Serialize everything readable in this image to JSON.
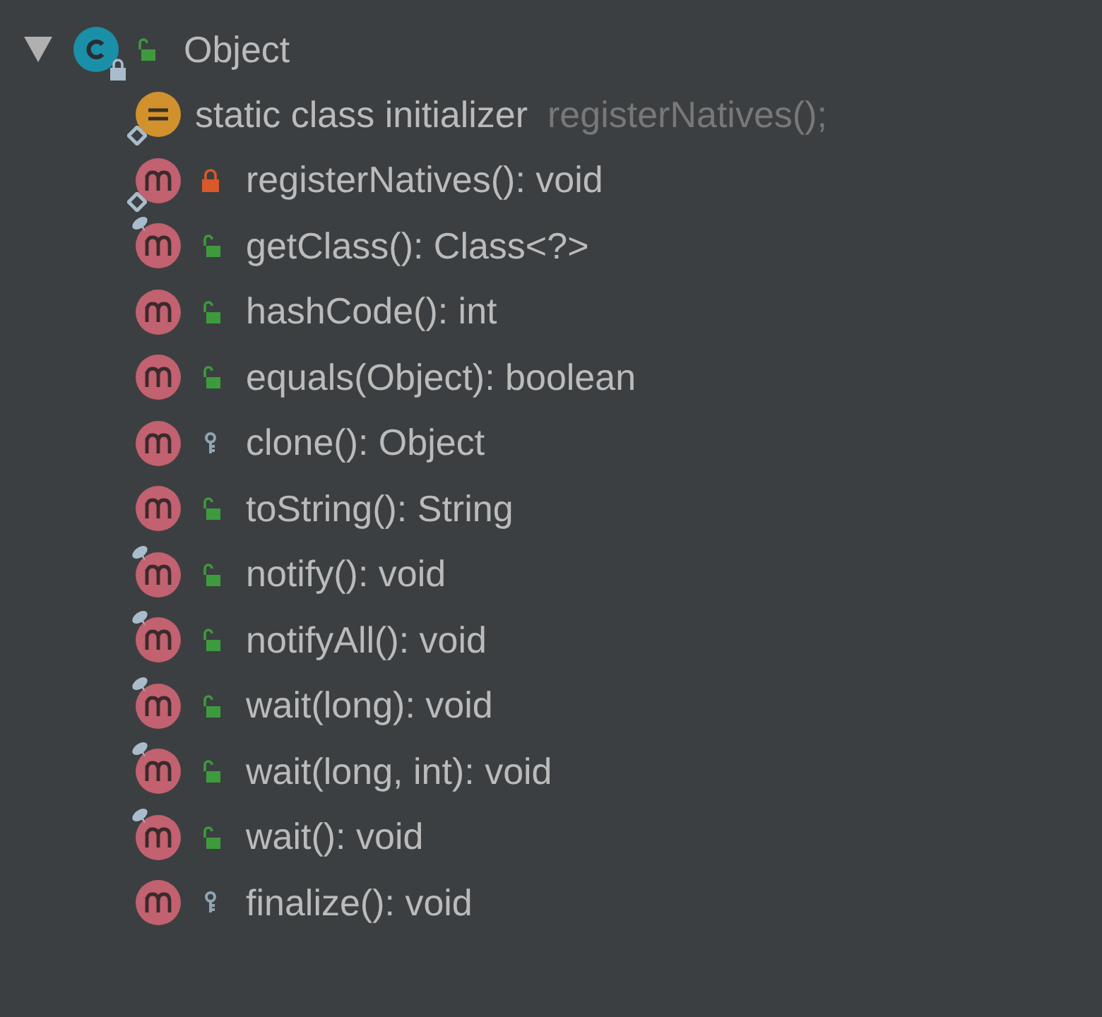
{
  "tree": {
    "expanded": true,
    "kind": "class",
    "overlay": {
      "kind": "lock"
    },
    "access": {
      "kind": "public"
    },
    "name": "Object",
    "children": [
      {
        "kind": "initializer",
        "overlay": {
          "kind": "static"
        },
        "name": "static class initializer",
        "hint": "registerNatives();"
      },
      {
        "kind": "method",
        "overlay": {
          "kind": "static"
        },
        "access": {
          "kind": "private"
        },
        "name": "registerNatives(): void"
      },
      {
        "kind": "method",
        "overlay": {
          "kind": "final"
        },
        "access": {
          "kind": "public"
        },
        "name": "getClass(): Class<?>"
      },
      {
        "kind": "method",
        "access": {
          "kind": "public"
        },
        "name": "hashCode(): int"
      },
      {
        "kind": "method",
        "access": {
          "kind": "public"
        },
        "name": "equals(Object): boolean"
      },
      {
        "kind": "method",
        "access": {
          "kind": "protected"
        },
        "name": "clone(): Object"
      },
      {
        "kind": "method",
        "access": {
          "kind": "public"
        },
        "name": "toString(): String"
      },
      {
        "kind": "method",
        "overlay": {
          "kind": "final"
        },
        "access": {
          "kind": "public"
        },
        "name": "notify(): void"
      },
      {
        "kind": "method",
        "overlay": {
          "kind": "final"
        },
        "access": {
          "kind": "public"
        },
        "name": "notifyAll(): void"
      },
      {
        "kind": "method",
        "overlay": {
          "kind": "final"
        },
        "access": {
          "kind": "public"
        },
        "name": "wait(long): void"
      },
      {
        "kind": "method",
        "overlay": {
          "kind": "final"
        },
        "access": {
          "kind": "public"
        },
        "name": "wait(long, int): void"
      },
      {
        "kind": "method",
        "overlay": {
          "kind": "final"
        },
        "access": {
          "kind": "public"
        },
        "name": "wait(): void"
      },
      {
        "kind": "method",
        "access": {
          "kind": "protected"
        },
        "name": "finalize(): void"
      }
    ]
  }
}
